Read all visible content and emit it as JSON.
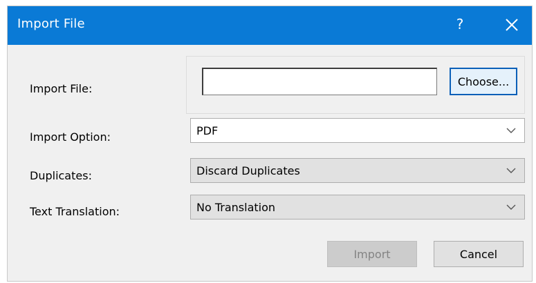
{
  "window": {
    "title": "Import File",
    "help_label": "?"
  },
  "form": {
    "import_file": {
      "label": "Import File:",
      "value": "",
      "choose_label": "Choose..."
    },
    "import_option": {
      "label": "Import Option:",
      "selected": "PDF"
    },
    "duplicates": {
      "label": "Duplicates:",
      "selected": "Discard Duplicates"
    },
    "text_translation": {
      "label": "Text Translation:",
      "selected": "No Translation"
    }
  },
  "buttons": {
    "import_label": "Import",
    "import_enabled": false,
    "cancel_label": "Cancel"
  },
  "colors": {
    "titlebar": "#0a7ad6",
    "dialog_background": "#f0f0f0",
    "focus_border": "#0a5fb8"
  },
  "icons": {
    "close": "close-icon",
    "dropdown": "chevron-down-icon"
  }
}
